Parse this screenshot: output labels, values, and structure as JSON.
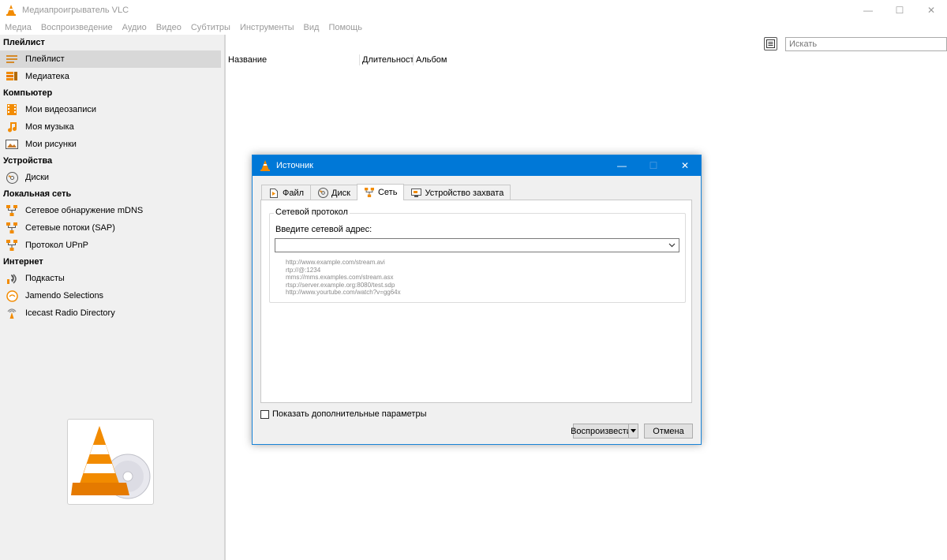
{
  "window": {
    "title": "Медиапроигрыватель VLC"
  },
  "menu": [
    "Медиа",
    "Воспроизведение",
    "Аудио",
    "Видео",
    "Субтитры",
    "Инструменты",
    "Вид",
    "Помощь"
  ],
  "sidebar": {
    "playlist_section": "Плейлист",
    "playlist_items": [
      "Плейлист",
      "Медиатека"
    ],
    "computer_section": "Компьютер",
    "computer_items": [
      "Мои видеозаписи",
      "Моя музыка",
      "Мои рисунки"
    ],
    "devices_section": "Устройства",
    "devices_items": [
      "Диски"
    ],
    "lan_section": "Локальная сеть",
    "lan_items": [
      "Сетевое обнаружение mDNS",
      "Сетевые потоки (SAP)",
      "Протокол UPnP"
    ],
    "internet_section": "Интернет",
    "internet_items": [
      "Подкасты",
      "Jamendo Selections",
      "Icecast Radio Directory"
    ]
  },
  "playlist": {
    "columns": [
      "Название",
      "Длительност",
      "Альбом"
    ],
    "search_placeholder": "Искать"
  },
  "dialog": {
    "title": "Источник",
    "tabs": [
      "Файл",
      "Диск",
      "Сеть",
      "Устройство захвата"
    ],
    "active_tab": "Сеть",
    "group_label": "Сетевой протокол",
    "address_label": "Введите сетевой адрес:",
    "address_value": "",
    "examples": [
      "http://www.example.com/stream.avi",
      "rtp://@:1234",
      "mms://mms.examples.com/stream.asx",
      "rtsp://server.example.org:8080/test.sdp",
      "http://www.yourtube.com/watch?v=gg64x"
    ],
    "show_more_label": "Показать дополнительные параметры",
    "show_more_checked": false,
    "play_label": "Воспроизвести",
    "cancel_label": "Отмена"
  },
  "colors": {
    "accent": "#0078d7",
    "vlc_orange": "#f28b00"
  }
}
